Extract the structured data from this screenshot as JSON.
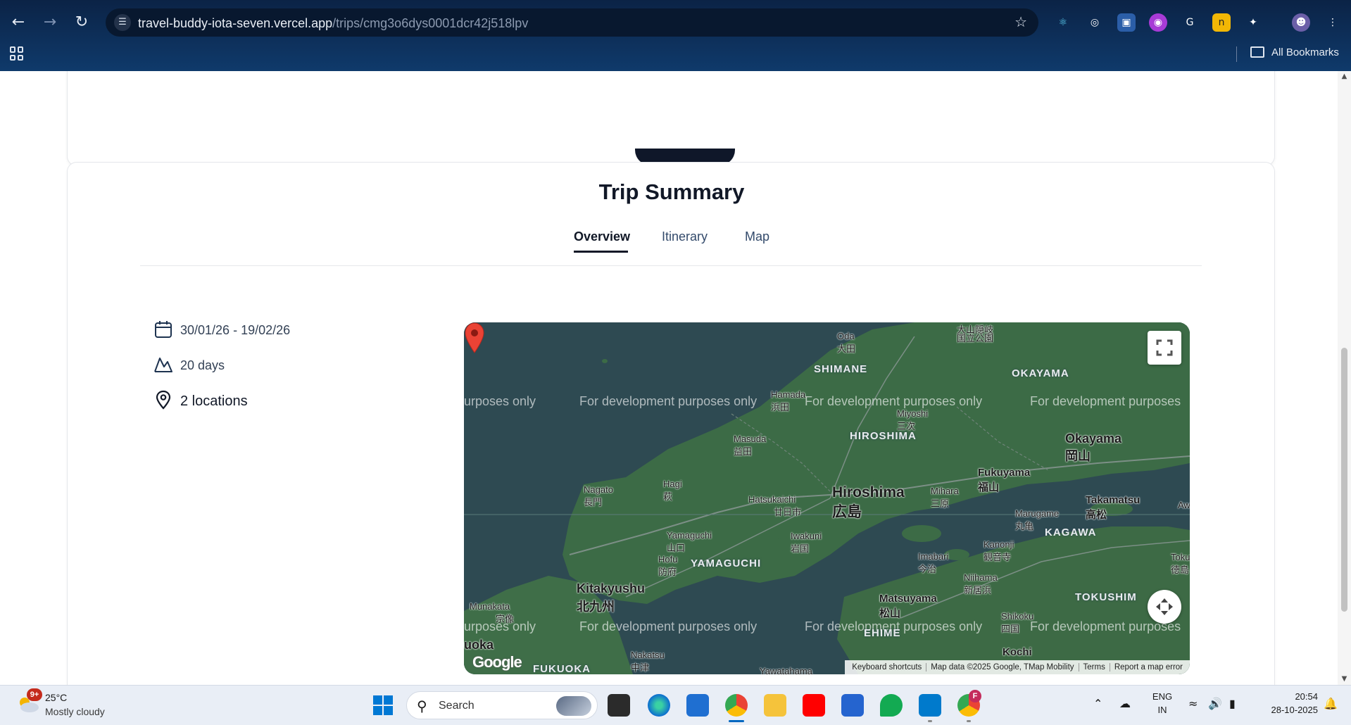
{
  "browser": {
    "url_host": "travel-buddy-iota-seven.vercel.app",
    "url_path": "/trips/cmg3o6dys0001dcr42j518lpv",
    "bookmarks_label": "All Bookmarks",
    "back_icon": "arrow-left-icon",
    "forward_icon": "arrow-right-icon",
    "reload_icon": "reload-icon"
  },
  "summary": {
    "title": "Trip Summary",
    "tabs": [
      {
        "label": "Overview",
        "active": true
      },
      {
        "label": "Itinerary",
        "active": false
      },
      {
        "label": "Map",
        "active": false
      }
    ],
    "dates": "30/01/26 - 19/02/26",
    "duration": "20 days",
    "locations": "2 locations"
  },
  "map": {
    "watermark": "For development purposes only",
    "watermark_partial": "urposes only",
    "watermark_partial_right": "For development purposes",
    "regions": {
      "shimane": "SHIMANE",
      "okayama_pref": "OKAYAMA",
      "hiroshima_pref": "HIROSHIMA",
      "yamaguchi": "YAMAGUCHI",
      "kagawa": "KAGAWA",
      "tokushima": "TOKUSHIM",
      "ehime": "EHIME",
      "fukuoka": "FUKUOKA"
    },
    "cities": {
      "hiroshima": "Hiroshima",
      "hiroshima_jp": "広島",
      "okayama": "Okayama",
      "okayama_jp": "岡山",
      "fukuyama": "Fukuyama",
      "fukuyama_jp": "福山",
      "kitakyushu": "Kitakyushu",
      "kitakyushu_jp": "北九州",
      "matsuyama": "Matsuyama",
      "matsuyama_jp": "松山",
      "takamatsu": "Takamatsu",
      "takamatsu_jp": "高松",
      "kochi": "Kochi",
      "oda": "Oda",
      "oda_jp": "大田",
      "hamada": "Hamada",
      "hamada_jp": "浜田",
      "miyoshi": "Miyoshi",
      "miyoshi_jp": "三次",
      "masuda": "Masuda",
      "masuda_jp": "益田",
      "hagi": "Hagi",
      "hagi_jp": "萩",
      "nagato": "Nagato",
      "nagato_jp": "長門",
      "hatsukaichi": "Hatsukaichi",
      "hatsukaichi_jp": "廿日市",
      "mihara": "Mihara",
      "mihara_jp": "三原",
      "yamaguchi": "Yamaguchi",
      "yamaguchi_jp": "山口",
      "iwakuni": "Iwakuni",
      "iwakuni_jp": "岩国",
      "hofu": "Hofu",
      "hofu_jp": "防府",
      "imabari": "Imabari",
      "imabari_jp": "今治",
      "niihama": "Niihama",
      "niihama_jp": "新居浜",
      "kanonji": "Kanonji",
      "kanonji_jp": "観音寺",
      "marugame": "Marugame",
      "marugame_jp": "丸亀",
      "munakata": "Munakata",
      "munakata_jp": "宗像",
      "nakatsu": "Nakatsu",
      "nakatsu_jp": "中津",
      "shikoku": "Shikoku",
      "shikoku_jp": "四国",
      "yawatahama": "Yawatahama",
      "daisen_jp": "大山隠岐",
      "daisen_jp2": "国立公園",
      "fukuoka_partial": "uoka",
      "tokushima_partial": "Toku",
      "tokushima_jp": "徳島",
      "aw_partial": "Aw"
    },
    "attribution": [
      "Keyboard shortcuts",
      "Map data ©2025 Google, TMap Mobility",
      "Terms",
      "Report a map error"
    ],
    "google_logo": "Google",
    "marker_color": "#ea4335"
  },
  "taskbar": {
    "weather_badge": "9+",
    "weather_temp": "25°C",
    "weather_desc": "Mostly cloudy",
    "search_label": "Search",
    "lang_top": "ENG",
    "lang_bottom": "IN",
    "time": "20:54",
    "date": "28-10-2025",
    "profile_badge": "F"
  },
  "colors": {
    "chrome_bg": "#0f3a6b",
    "text_dark": "#111827",
    "tab_inactive": "#334a6b",
    "map_water": "#2e4a52",
    "map_land": "#3c6b46"
  }
}
